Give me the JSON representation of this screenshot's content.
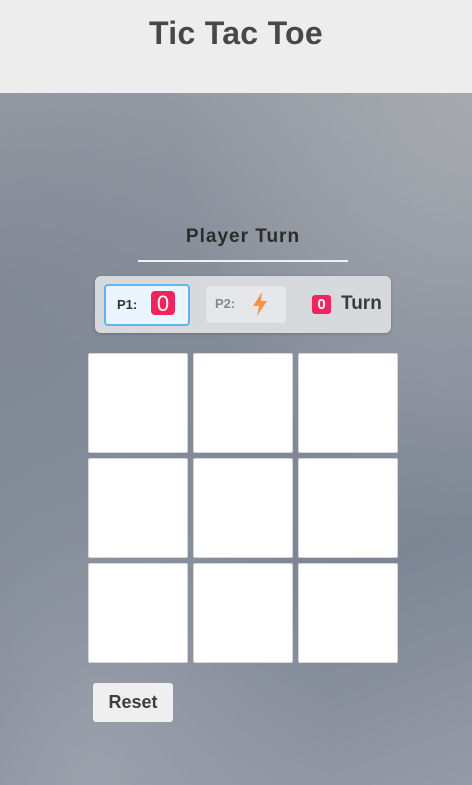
{
  "app": {
    "title": "Tic Tac Toe"
  },
  "status": {
    "heading": "Player Turn"
  },
  "scoreboard": {
    "player1": {
      "label": "P1:",
      "mark": "0",
      "active": true
    },
    "player2": {
      "label": "P2:",
      "mark_icon": "lightning-bolt-icon",
      "active": false
    },
    "turn": {
      "indicator": "0",
      "label": "Turn"
    }
  },
  "board": {
    "cells": [
      "",
      "",
      "",
      "",
      "",
      "",
      "",
      "",
      ""
    ]
  },
  "controls": {
    "reset_label": "Reset"
  },
  "colors": {
    "accent_pink": "#f0245f",
    "active_blue": "#5db4ee",
    "bolt_orange": "#f4944c"
  }
}
